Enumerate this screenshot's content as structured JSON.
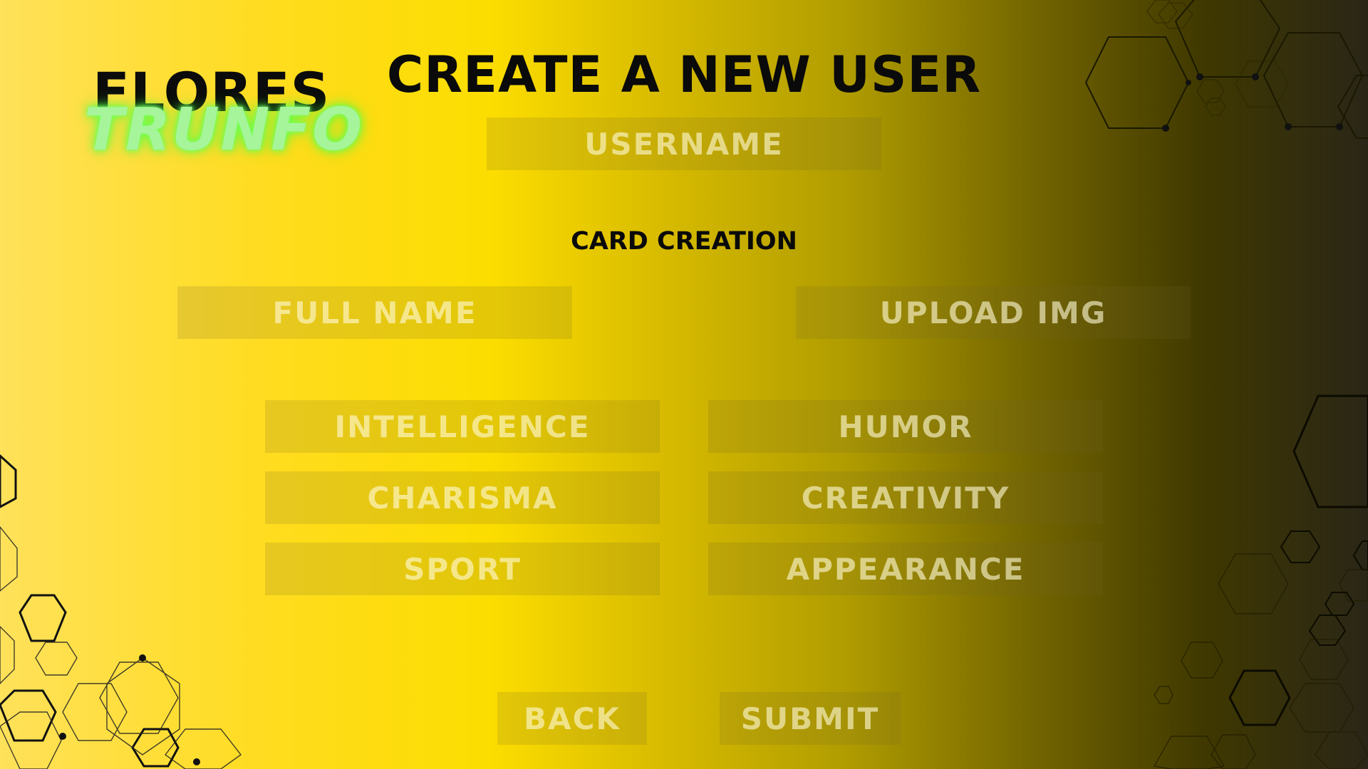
{
  "logo": {
    "top": "FLORES",
    "bottom": "TRUNFO"
  },
  "header": {
    "title": "CREATE A NEW USER"
  },
  "account": {
    "username_placeholder": "USERNAME"
  },
  "card": {
    "section_title": "CARD CREATION",
    "full_name_placeholder": "FULL NAME",
    "upload_label": "UPLOAD IMG",
    "attributes": {
      "intelligence": "INTELLIGENCE",
      "humor": "HUMOR",
      "charisma": "CHARISMA",
      "creativity": "CREATIVITY",
      "sport": "SPORT",
      "appearance": "APPEARANCE"
    }
  },
  "actions": {
    "back": "BACK",
    "submit": "SUBMIT"
  },
  "theme": {
    "accent_yellow": "#fcdd00",
    "logo_glow": "#58ff45",
    "dark": "#2a2617"
  },
  "decorations": {
    "pattern": "hexagon-outline-pattern"
  }
}
